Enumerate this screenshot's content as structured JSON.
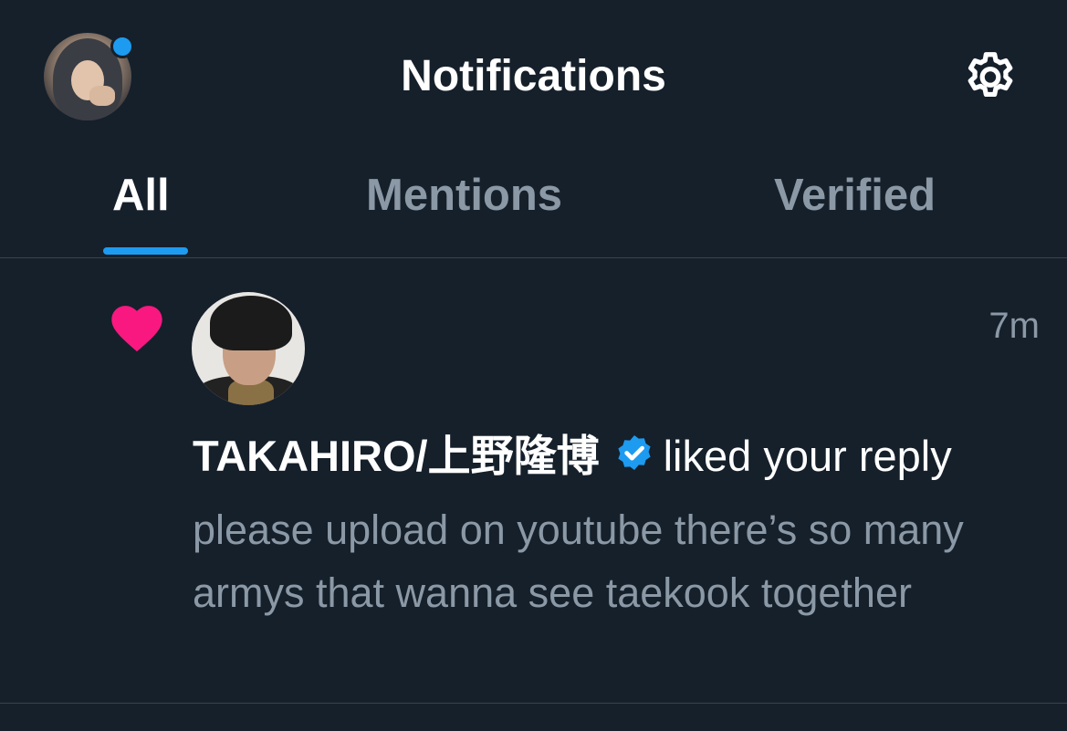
{
  "header": {
    "title": "Notifications",
    "profile_avatar_icon": "user-avatar",
    "settings_icon": "gear-icon"
  },
  "tabs": [
    {
      "label": "All",
      "active": true
    },
    {
      "label": "Mentions",
      "active": false
    },
    {
      "label": "Verified",
      "active": false
    }
  ],
  "notification": {
    "type_icon": "heart-icon",
    "user_name": "TAKAHIRO/上野隆博",
    "verified": true,
    "action": "liked your reply",
    "timestamp": "7m",
    "reply_text": "please upload on youtube there’s so many armys that wanna see taekook together"
  },
  "colors": {
    "background": "#15202b",
    "accent": "#1d9bf0",
    "like": "#f91880",
    "secondary_text": "#8b98a5",
    "divider": "#38444d"
  }
}
